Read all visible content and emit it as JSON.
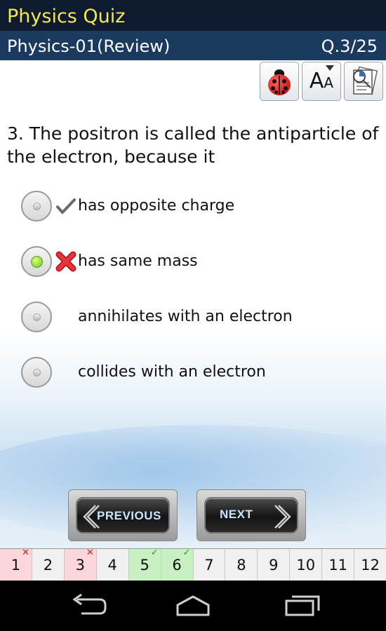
{
  "app": {
    "title": "Physics Quiz"
  },
  "header": {
    "quiz_name": "Physics-01(Review)",
    "question_counter": "Q.3/25"
  },
  "toolbar": {
    "icons": [
      "ladybug-icon",
      "font-size-icon",
      "notes-icon"
    ],
    "font_icon_big": "A",
    "font_icon_small": "A"
  },
  "question": {
    "text": "3.  The positron is called the antiparticle of the electron, because it"
  },
  "options": [
    {
      "text": "has opposite charge",
      "selected": false,
      "mark": "correct"
    },
    {
      "text": "has same mass",
      "selected": true,
      "mark": "wrong"
    },
    {
      "text": "annihilates with an electron",
      "selected": false,
      "mark": ""
    },
    {
      "text": "collides with an electron",
      "selected": false,
      "mark": ""
    }
  ],
  "nav": {
    "previous_label": "PREVIOUS",
    "next_label": "NEXT"
  },
  "pager": {
    "pages": [
      {
        "label": "1",
        "status": "wrong",
        "flag": "✕"
      },
      {
        "label": "2",
        "status": "",
        "flag": ""
      },
      {
        "label": "3",
        "status": "wrong",
        "flag": "✕"
      },
      {
        "label": "4",
        "status": "",
        "flag": ""
      },
      {
        "label": "5",
        "status": "right",
        "flag": "✓"
      },
      {
        "label": "6",
        "status": "right",
        "flag": "✓"
      },
      {
        "label": "7",
        "status": "",
        "flag": ""
      },
      {
        "label": "8",
        "status": "",
        "flag": ""
      },
      {
        "label": "9",
        "status": "",
        "flag": ""
      },
      {
        "label": "10",
        "status": "",
        "flag": ""
      },
      {
        "label": "11",
        "status": "",
        "flag": ""
      },
      {
        "label": "12",
        "status": "",
        "flag": ""
      }
    ]
  },
  "colors": {
    "title_bar": "#0d1a2f",
    "title_text": "#f4e94a",
    "sub_bar": "#1b3a5f",
    "wrong_bg": "#fbd7dc",
    "right_bg": "#c8f0c0"
  }
}
